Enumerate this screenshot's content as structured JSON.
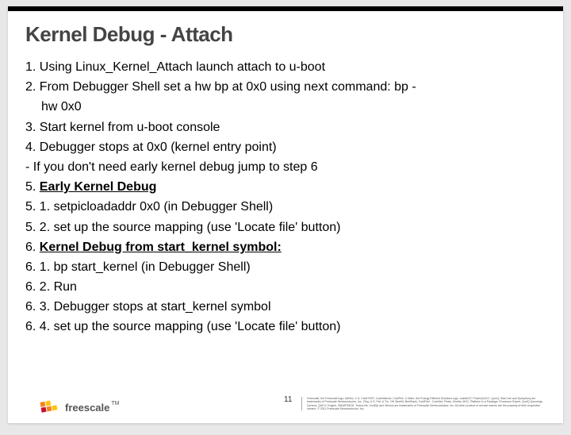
{
  "title": "Kernel Debug - Attach",
  "steps": {
    "s1": "1. Using Linux_Kernel_Attach  launch attach to u-boot",
    "s2": "2. From Debugger Shell set a hw bp at 0x0 using next command: bp -",
    "s2b": "hw 0x0",
    "s3": "3. Start kernel from u-boot console",
    "s4": "4. Debugger stops at 0x0 (kernel entry point)",
    "dash1": "If you don't need early kernel debug jump to step 6",
    "s5pre": "5. ",
    "s5": "Early Kernel Debug",
    "s51": "5. 1. setpicloadaddr 0x0 (in Debugger Shell)",
    "s52": "5. 2. set up the source mapping (use 'Locate file' button)",
    "s6pre": "6. ",
    "s6": "Kernel Debug from start_kernel symbol:",
    "s61": "6. 1. bp start_kernel (in Debugger Shell)",
    "s62": "6. 2. Run",
    "s63": "6. 3. Debugger stops at start_kernel symbol",
    "s64": "6. 4. set up the source mapping (use 'Locate file' button)"
  },
  "footer": {
    "logo_text": "freescale",
    "tm": "TM",
    "page_number": "11",
    "legal": "Freescale, the Freescale logo, AltiVec, C-5, CodeTEST, CodeWarrior, ColdFire, C-Ware, the Energy Efficient Solutions logo, mobileGT, PowerQUICC, QorIQ, StarCore and Symphony are trademarks of Freescale Semiconductor, Inc., Reg. U.S. Pat. & Tm. Off. BeeKit, BeeStack, ColdFire+, CoreNet, Flexis, Kinetis, MXC, Platform in a Package, Processor Expert, QorIQ Qonverge, Qorivva, QUICC Engine, SMARTMOS, TurboLink, VortiQa and Xtrinsic are trademarks of Freescale Semiconductor, Inc. All other product or service names are the property of their respective owners. © 2011 Freescale Semiconductor, Inc."
  }
}
